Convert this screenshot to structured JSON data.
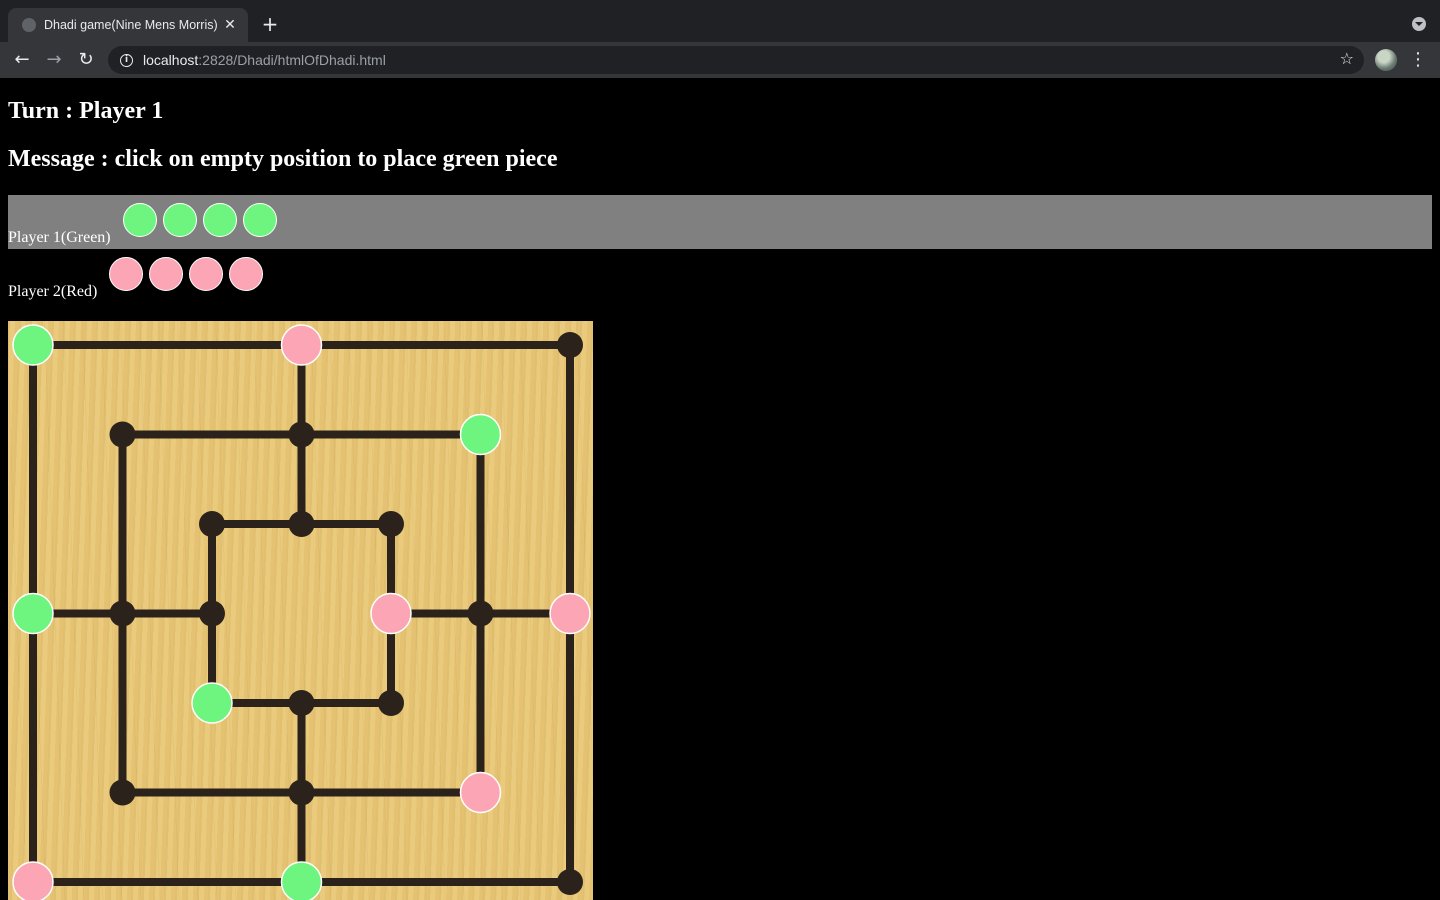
{
  "browser": {
    "tab_title": "Dhadi game(Nine Mens Morris)",
    "url_host": "localhost",
    "url_rest": ":2828/Dhadi/htmlOfDhadi.html",
    "icons": {
      "back": "arrow-left-icon",
      "forward": "arrow-right-icon",
      "reload": "reload-icon",
      "info": "info-icon",
      "bookmark": "star-icon",
      "menu": "kebab-menu-icon",
      "close_tab": "close-icon",
      "new_tab": "plus-icon"
    }
  },
  "game": {
    "turn": "Turn : Player 1",
    "message": "Message : click on empty position to place green piece",
    "players": [
      {
        "label": "Player 1(Green)",
        "color": "green",
        "color_hex": "#6ef57f",
        "remaining": 4,
        "highlighted": true
      },
      {
        "label": "Player 2(Red)",
        "color": "red",
        "color_hex": "#fca5b5",
        "remaining": 4,
        "highlighted": false
      }
    ],
    "board": {
      "type": "nine-mens-morris",
      "grid": [
        "a",
        "b",
        "c",
        "d",
        "e",
        "f",
        "g"
      ],
      "positions": [
        {
          "point": "a7",
          "piece": "green"
        },
        {
          "point": "d7",
          "piece": "red"
        },
        {
          "point": "g7",
          "piece": null
        },
        {
          "point": "b6",
          "piece": null
        },
        {
          "point": "d6",
          "piece": null
        },
        {
          "point": "f6",
          "piece": "green"
        },
        {
          "point": "c5",
          "piece": null
        },
        {
          "point": "d5",
          "piece": null
        },
        {
          "point": "e5",
          "piece": null
        },
        {
          "point": "a4",
          "piece": "green"
        },
        {
          "point": "b4",
          "piece": null
        },
        {
          "point": "c4",
          "piece": null
        },
        {
          "point": "e4",
          "piece": "red"
        },
        {
          "point": "f4",
          "piece": null
        },
        {
          "point": "g4",
          "piece": "red"
        },
        {
          "point": "c3",
          "piece": "green"
        },
        {
          "point": "d3",
          "piece": null
        },
        {
          "point": "e3",
          "piece": null
        },
        {
          "point": "b2",
          "piece": null
        },
        {
          "point": "d2",
          "piece": null
        },
        {
          "point": "f2",
          "piece": "red"
        },
        {
          "point": "a1",
          "piece": "red"
        },
        {
          "point": "d1",
          "piece": "green"
        },
        {
          "point": "g1",
          "piece": null
        }
      ],
      "colors": {
        "board": "#e9c878",
        "line": "#2a221b",
        "green": "#6ef57f",
        "red": "#fca5b5"
      }
    }
  }
}
